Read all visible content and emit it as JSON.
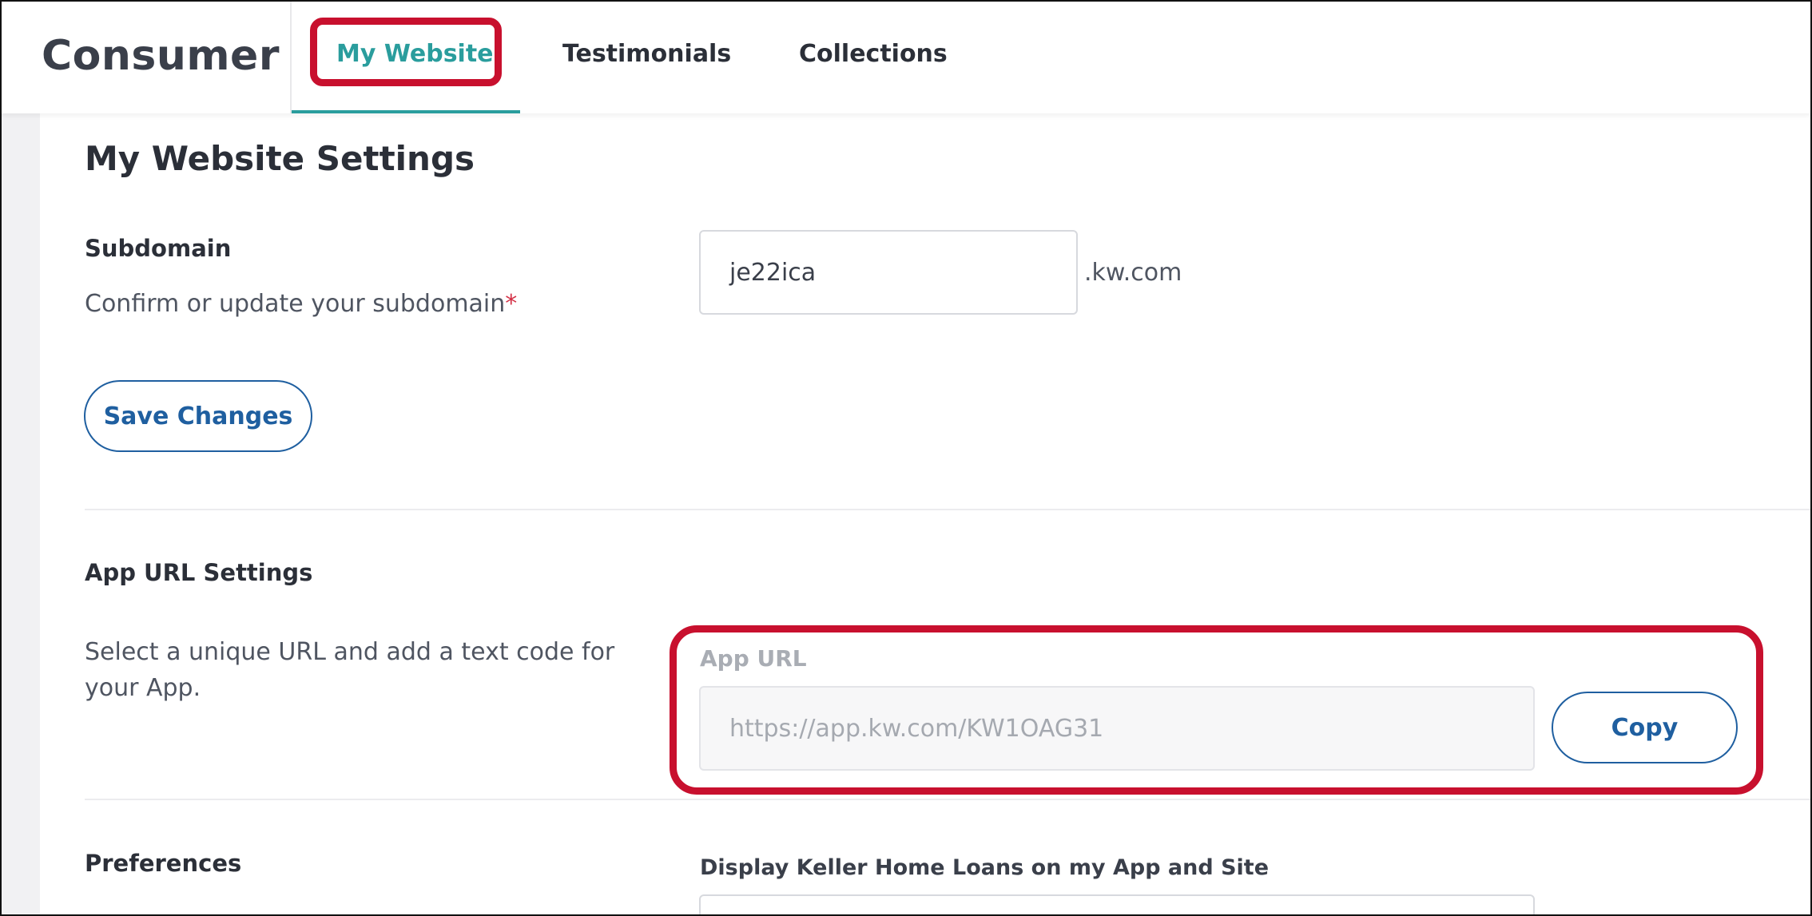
{
  "header": {
    "brand": "Consumer",
    "tabs": [
      {
        "label": "My Website",
        "active": true
      },
      {
        "label": "Testimonials",
        "active": false
      },
      {
        "label": "Collections",
        "active": false
      }
    ]
  },
  "page": {
    "title": "My Website Settings"
  },
  "subdomain": {
    "heading": "Subdomain",
    "description": "Confirm or update your subdomain",
    "required_mark": "*",
    "value": "je22ica",
    "suffix": ".kw.com"
  },
  "actions": {
    "save_label": "Save Changes"
  },
  "app_url": {
    "heading": "App URL Settings",
    "description": "Select a unique URL and add a text code for your App.",
    "field_label": "App URL",
    "value": "https://app.kw.com/KW1OAG31",
    "copy_label": "Copy"
  },
  "preferences": {
    "heading": "Preferences",
    "field_label": "Display Keller Home Loans on my App and Site"
  },
  "colors": {
    "accent_teal": "#2a9d9d",
    "button_blue": "#1f5fa0",
    "highlight_red": "#c8102e",
    "required_red": "#d32f45"
  }
}
